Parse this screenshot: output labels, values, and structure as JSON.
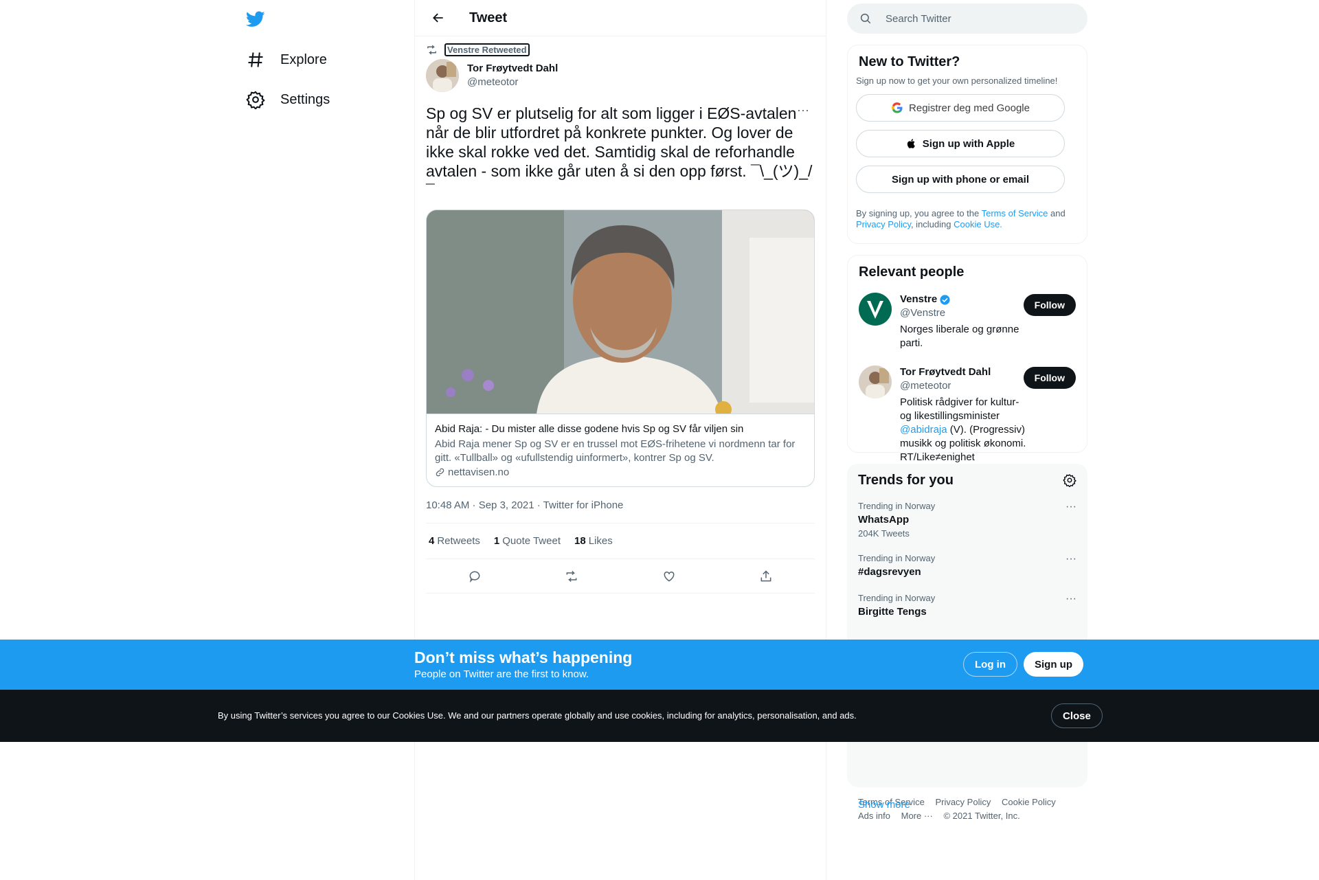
{
  "nav": {
    "items": [
      {
        "label": "Explore",
        "icon": "hashtag-icon"
      },
      {
        "label": "Settings",
        "icon": "gear-icon"
      }
    ]
  },
  "header": {
    "title": "Tweet"
  },
  "tweet": {
    "retweeted_by": "Venstre Retweeted",
    "author_name": "Tor Frøytvedt Dahl",
    "author_handle": "@meteotor",
    "text": "Sp og SV er plutselig for alt som ligger i EØS-avtalen når de blir utfordret på konkrete punkter. Og lover de ikke skal rokke ved det. Samtidig skal de reforhandle avtalen - som ikke går uten å si den opp først. ¯\\_(ツ)_/¯",
    "card": {
      "title": "Abid Raja: - Du mister alle disse godene hvis Sp og SV får viljen sin",
      "description": "Abid Raja mener Sp og SV er en trussel mot EØS-frihetene vi nordmenn tar for gitt. «Tullball» og «ufullstendig uinformert», kontrer Sp og SV.",
      "domain": "nettavisen.no"
    },
    "meta": "10:48 AM · Sep 3, 2021 · Twitter for iPhone",
    "stats": {
      "retweets_count": "4",
      "retweets_label": "Retweets",
      "quotes_count": "1",
      "quotes_label": "Quote Tweet",
      "likes_count": "18",
      "likes_label": "Likes"
    }
  },
  "search": {
    "placeholder": "Search Twitter"
  },
  "signup_panel": {
    "title": "New to Twitter?",
    "subtitle": "Sign up now to get your own personalized timeline!",
    "google_label": "Registrer deg med Google",
    "apple_label": "Sign up with Apple",
    "phone_label": "Sign up with phone or email",
    "legal_1": "By signing up, you agree to the ",
    "terms": "Terms of Service",
    "legal_2": " and ",
    "privacy": "Privacy Policy",
    "legal_3": ", including ",
    "cookie": "Cookie Use."
  },
  "relevant": {
    "title": "Relevant people",
    "people": [
      {
        "name": "Venstre",
        "handle": "@Venstre",
        "bio": "Norges liberale og grønne parti.",
        "follow": "Follow"
      },
      {
        "name": "Tor Frøytvedt Dahl",
        "handle": "@meteotor",
        "bio_1": "Politisk rådgiver for kultur- og likestillingsminister ",
        "bio_link": "@abidraja",
        "bio_2": " (V). (Progressiv) musikk og politisk økonomi. RT/Like≠enighet",
        "follow": "Follow"
      }
    ]
  },
  "trends": {
    "title": "Trends for you",
    "items": [
      {
        "context": "Trending in Norway",
        "name": "WhatsApp",
        "count": "204K Tweets"
      },
      {
        "context": "Trending in Norway",
        "name": "#dagsrevyen",
        "count": ""
      },
      {
        "context": "Trending in Norway",
        "name": "Birgitte Tengs",
        "count": ""
      }
    ],
    "show_more": "Show more"
  },
  "footer": {
    "links": [
      "Terms of Service",
      "Privacy Policy",
      "Cookie Policy"
    ],
    "ads": "Ads info",
    "more": "More ···",
    "copyright": "© 2021 Twitter, Inc."
  },
  "banner": {
    "title": "Don’t miss what’s happening",
    "subtitle": "People on Twitter are the first to know.",
    "login": "Log in",
    "signup": "Sign up"
  },
  "cookie_bar": {
    "text": "By using Twitter’s services you agree to our Cookies Use. We and our partners operate globally and use cookies, including for analytics, personalisation, and ads.",
    "close": "Close"
  },
  "colors": {
    "accent": "#1d9bf0",
    "text": "#0f1419",
    "secondary": "#536471",
    "venstre": "#006a53"
  }
}
